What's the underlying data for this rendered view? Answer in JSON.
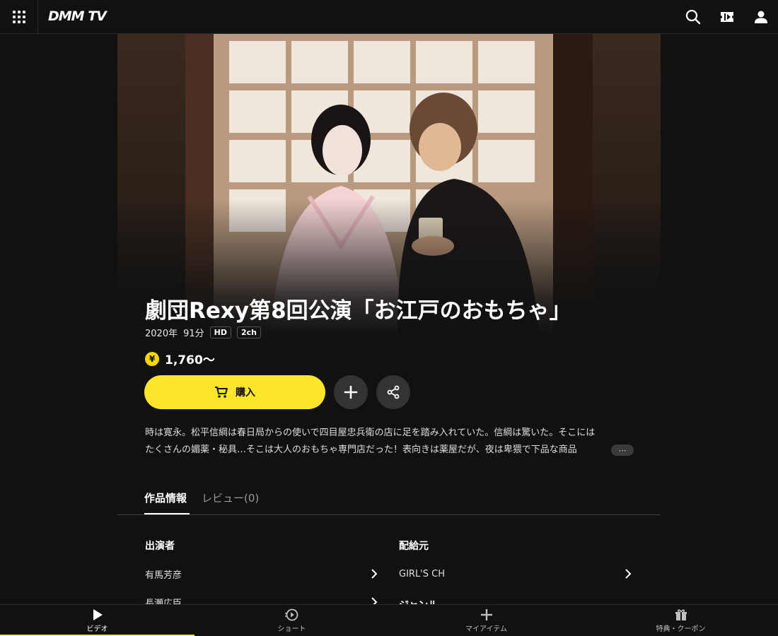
{
  "header": {
    "logo": "DMM TV",
    "icons": [
      "grid-menu-icon",
      "search-icon",
      "ticket-icon",
      "user-icon"
    ]
  },
  "work": {
    "title": "劇団Rexy第8回公演「お江戸のおもちゃ」",
    "year": "2020年",
    "duration": "91分",
    "badges": [
      "HD",
      "2ch"
    ],
    "price": "1,760〜",
    "price_symbol": "¥",
    "buy_label": "購入",
    "description_line1": "時は寛永。松平信綱は春日局からの使いで四目屋忠兵衛の店に足を踏み入れていた。信綱は驚いた。そこには",
    "description_line2": "たくさんの媚薬・秘具…そこは大人のおもちゃ専門店だった！表向きは薬屋だが、夜は卑猥で下品な商品",
    "more_label": "⋯"
  },
  "tabs": [
    {
      "label": "作品情報",
      "active": true
    },
    {
      "label": "レビュー(0)",
      "active": false
    }
  ],
  "info": {
    "cast_heading": "出演者",
    "cast": [
      "有馬芳彦",
      "長瀬広臣"
    ],
    "distributor_heading": "配給元",
    "distributor": "GIRL'S CH",
    "genre_heading": "ジャンル"
  },
  "bottom_nav": [
    {
      "label": "ビデオ",
      "icon": "play-icon",
      "active": true
    },
    {
      "label": "ショート",
      "icon": "short-play-icon",
      "active": false
    },
    {
      "label": "マイアイテム",
      "icon": "plus-icon",
      "active": false
    },
    {
      "label": "特典・クーポン",
      "icon": "gift-icon",
      "active": false
    }
  ],
  "colors": {
    "accent": "#fce62b",
    "background": "#111111",
    "button_dark": "#333333"
  }
}
